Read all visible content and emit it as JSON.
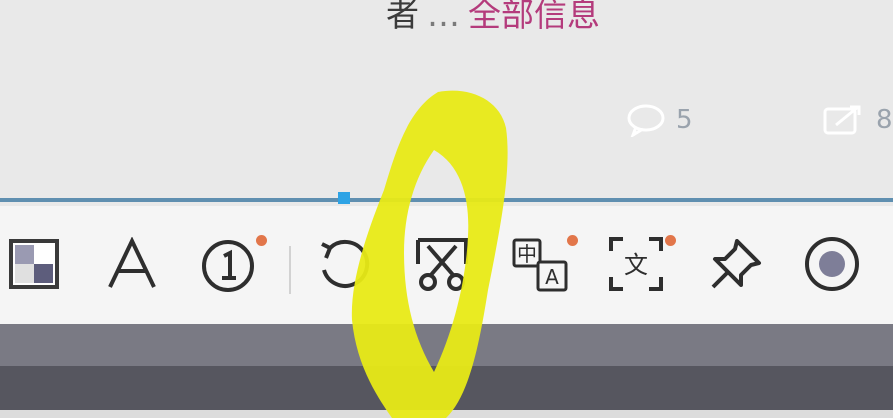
{
  "feed": {
    "author_suffix": "者",
    "ellipsis": "…",
    "more_link": "全部信息"
  },
  "stats": {
    "comments_count": "5",
    "reposts_count": "8"
  },
  "toolbar": {
    "tools": [
      {
        "name": "mosaic-icon"
      },
      {
        "name": "text-icon"
      },
      {
        "name": "sequence-number-icon",
        "badge": true
      },
      {
        "name": "undo-icon"
      },
      {
        "name": "scissors-icon"
      },
      {
        "name": "translate-icon",
        "badge": true
      },
      {
        "name": "text-recognition-icon",
        "badge": true
      },
      {
        "name": "pin-icon"
      },
      {
        "name": "record-icon"
      }
    ],
    "badge_color": "#e2764a",
    "selection_color": "#2ea3e5"
  },
  "annotation": {
    "marker_color": "#e8ea16"
  }
}
